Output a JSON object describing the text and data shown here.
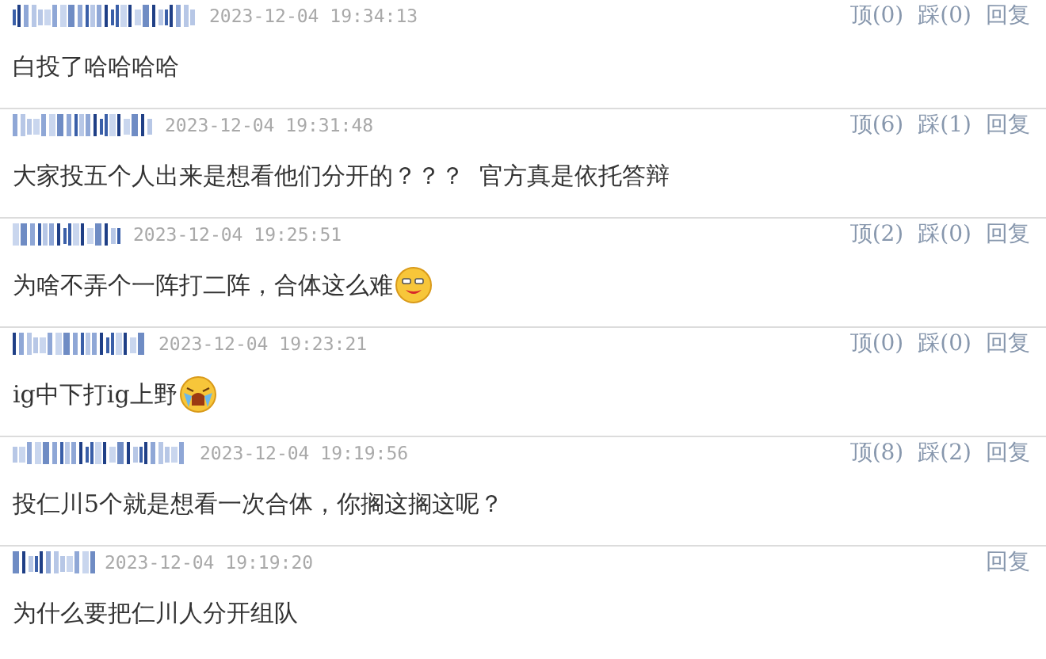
{
  "comments": [
    {
      "time": "2023-12-04 19:34:13",
      "text": "白投了哈哈哈哈",
      "up": "顶(0)",
      "down": "踩(0)",
      "reply": "回复"
    },
    {
      "time": "2023-12-04 19:31:48",
      "text": "大家投五个人出来是想看他们分开的？？？  官方真是依托答辩",
      "up": "顶(6)",
      "down": "踩(1)",
      "reply": "回复"
    },
    {
      "time": "2023-12-04 19:25:51",
      "text": "为啥不弄个一阵打二阵，合体这么难",
      "emoji": {
        "kind": "smug"
      },
      "up": "顶(2)",
      "down": "踩(0)",
      "reply": "回复"
    },
    {
      "time": "2023-12-04 19:23:21",
      "text": "ig中下打ig上野",
      "emoji": {
        "kind": "cry"
      },
      "up": "顶(0)",
      "down": "踩(0)",
      "reply": "回复"
    },
    {
      "time": "2023-12-04 19:19:56",
      "text": "投仁川5个就是想看一次合体，你搁这搁这呢？",
      "up": "顶(8)",
      "down": "踩(2)",
      "reply": "回复"
    },
    {
      "time": "2023-12-04 19:19:20",
      "text": "为什么要把仁川人分开组队",
      "reply": "回复"
    }
  ]
}
